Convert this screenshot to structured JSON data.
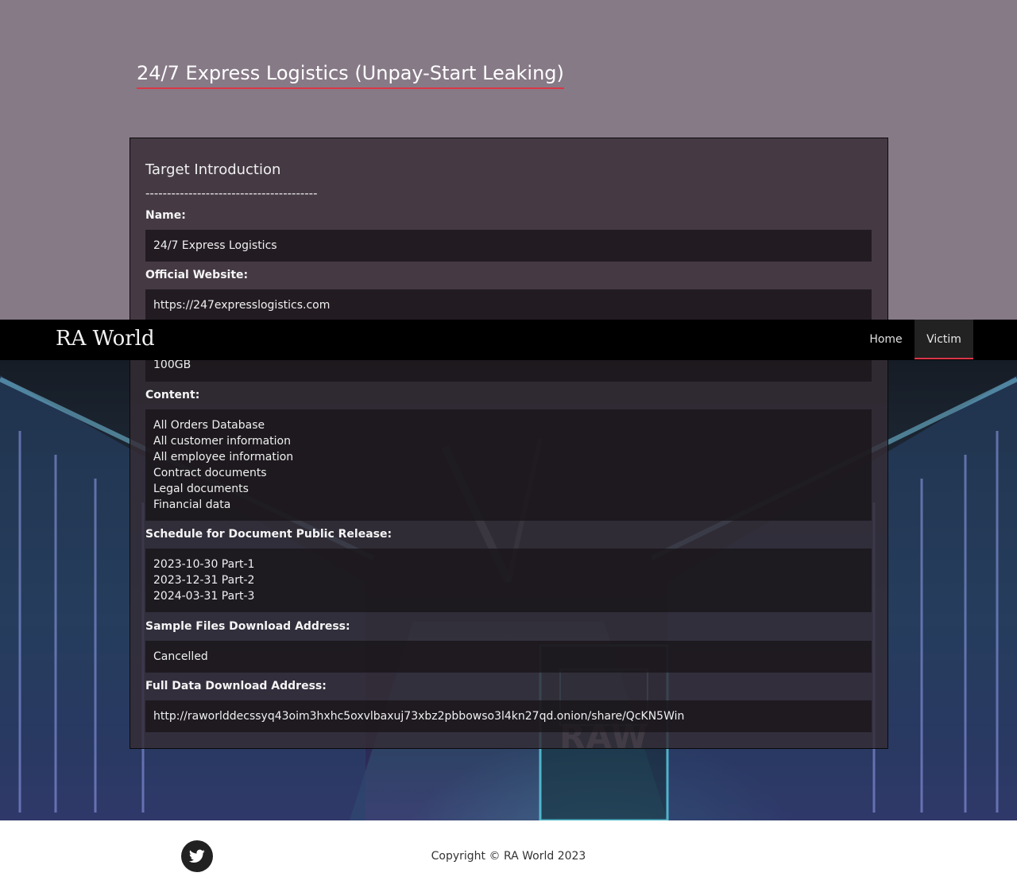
{
  "navbar": {
    "brand": "RA World",
    "items": [
      {
        "label": "Home"
      },
      {
        "label": "Victim"
      }
    ]
  },
  "page": {
    "title": "24/7 Express Logistics (Unpay-Start Leaking)"
  },
  "card": {
    "section_title": "Target Introduction",
    "divider": "----------------------------------------",
    "fields": {
      "name": {
        "label": "Name:",
        "value": "24/7 Express Logistics"
      },
      "website": {
        "label": "Official Website:",
        "value": "https://247expresslogistics.com"
      },
      "size": {
        "value": "100GB"
      },
      "content": {
        "label": "Content:",
        "lines": [
          "All Orders Database",
          "All customer information",
          "All employee information",
          "Contract documents",
          "Legal documents",
          "Financial data"
        ]
      },
      "schedule": {
        "label": "Schedule for Document Public Release:",
        "lines": [
          "2023-10-30 Part-1",
          "2023-12-31 Part-2",
          "2024-03-31 Part-3"
        ]
      },
      "sample": {
        "label": "Sample Files Download Address:",
        "value": "Cancelled"
      },
      "full": {
        "label": "Full Data Download Address:",
        "value": "http://raworlddecssyq43oim3hxhc5oxvlbaxuj73xbz2pbbowso3l4kn27qd.onion/share/QcKN5Win"
      }
    }
  },
  "background": {
    "watermark": "RAW"
  },
  "footer": {
    "copyright": "Copyright © RA World 2023",
    "social_icon": "twitter-icon"
  },
  "colors": {
    "accent": "#dc3545",
    "top_band": "#877a87",
    "navbar": "#000000"
  }
}
